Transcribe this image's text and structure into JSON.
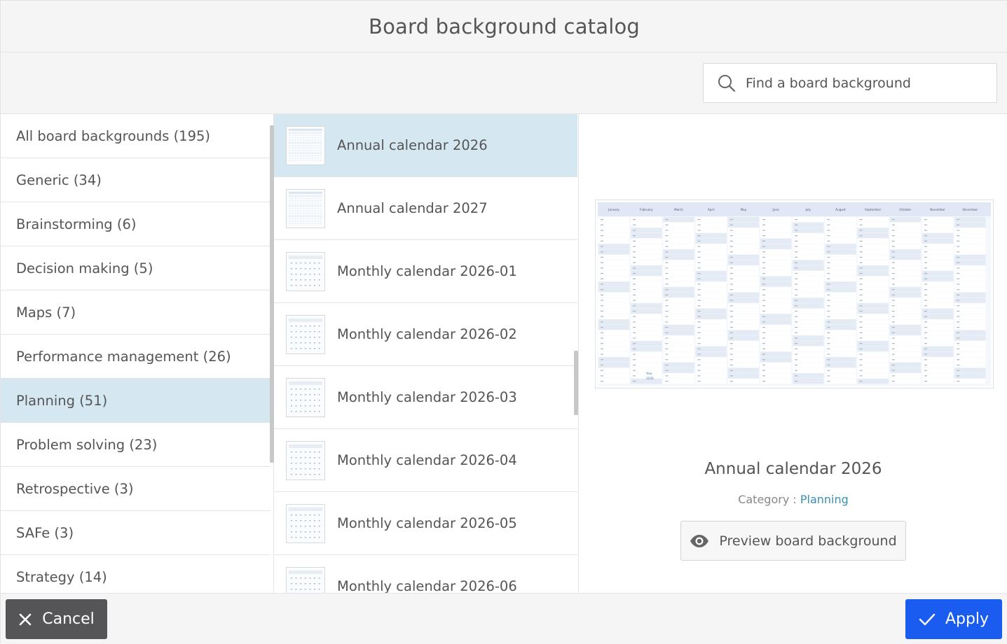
{
  "dialog": {
    "title": "Board background catalog"
  },
  "search": {
    "placeholder": "Find a board background"
  },
  "categories": [
    {
      "label": "All board backgrounds (195)",
      "selected": false
    },
    {
      "label": "Generic (34)",
      "selected": false
    },
    {
      "label": "Brainstorming (6)",
      "selected": false
    },
    {
      "label": "Decision making (5)",
      "selected": false
    },
    {
      "label": "Maps (7)",
      "selected": false
    },
    {
      "label": "Performance management (26)",
      "selected": false
    },
    {
      "label": "Planning (51)",
      "selected": true
    },
    {
      "label": "Problem solving (23)",
      "selected": false
    },
    {
      "label": "Retrospective (3)",
      "selected": false
    },
    {
      "label": "SAFe (3)",
      "selected": false
    },
    {
      "label": "Strategy (14)",
      "selected": false
    }
  ],
  "templates": [
    {
      "label": "Annual calendar 2026",
      "selected": true,
      "thumb": "annual"
    },
    {
      "label": "Annual calendar 2027",
      "selected": false,
      "thumb": "annual"
    },
    {
      "label": "Monthly calendar 2026-01",
      "selected": false,
      "thumb": "monthly"
    },
    {
      "label": "Monthly calendar 2026-02",
      "selected": false,
      "thumb": "monthly"
    },
    {
      "label": "Monthly calendar 2026-03",
      "selected": false,
      "thumb": "monthly"
    },
    {
      "label": "Monthly calendar 2026-04",
      "selected": false,
      "thumb": "monthly"
    },
    {
      "label": "Monthly calendar 2026-05",
      "selected": false,
      "thumb": "monthly"
    },
    {
      "label": "Monthly calendar 2026-06",
      "selected": false,
      "thumb": "monthly"
    }
  ],
  "preview": {
    "title": "Annual calendar 2026",
    "category_label": "Category :",
    "category_value": "Planning",
    "preview_button_label": "Preview board background",
    "image": {
      "months": [
        "January",
        "February",
        "March",
        "April",
        "May",
        "June",
        "July",
        "August",
        "September",
        "October",
        "November",
        "December"
      ],
      "year_label": "Year",
      "year_value": "2026"
    }
  },
  "footer": {
    "cancel_label": "Cancel",
    "apply_label": "Apply"
  },
  "colors": {
    "selected_bg": "#d5e8f2",
    "apply_bg": "#1a5cf0",
    "cancel_bg": "#555558",
    "link": "#3a8fb4"
  },
  "icons": {
    "search": "search-icon",
    "eye": "eye-icon",
    "close": "close-icon",
    "check": "check-icon"
  }
}
